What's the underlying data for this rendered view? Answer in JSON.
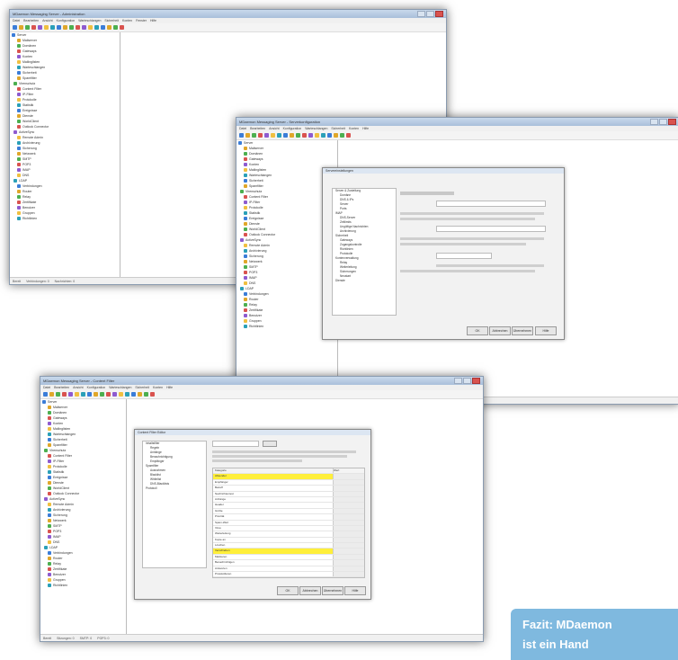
{
  "windows": [
    {
      "id": "main",
      "title": "MDaemon Messaging Server - Administration",
      "menus": [
        "Datei",
        "Bearbeiten",
        "Ansicht",
        "Konfiguration",
        "Warteschlangen",
        "Sicherheit",
        "Konten",
        "Fenster",
        "Hilfe"
      ],
      "tree": [
        "Server",
        "Mailserver",
        "Domänen",
        "Gateways",
        "Konten",
        "Mailinglisten",
        "Warteschlangen",
        "Sicherheit",
        "Spamfilter",
        "Virenschutz",
        "Content Filter",
        "IP-Filter",
        "Protokolle",
        "Statistik",
        "Ereignisse",
        "Dienste",
        "WorldClient",
        "Outlook Connector",
        "ActiveSync",
        "Remote Admin",
        "Archivierung",
        "Sicherung",
        "Netzwerk",
        "SMTP",
        "POP3",
        "IMAP",
        "DNS",
        "LDAP",
        "Verbindungen",
        "Router",
        "Relay",
        "Zertifikate",
        "Benutzer",
        "Gruppen",
        "Richtlinien"
      ],
      "status": [
        "Bereit",
        "Verbindungen: 0",
        "Nachrichten: 0"
      ]
    },
    {
      "id": "settings",
      "title": "MDaemon Messaging Server - Serverkonfiguration",
      "menus": [
        "Datei",
        "Bearbeiten",
        "Ansicht",
        "Konfiguration",
        "Warteschlangen",
        "Sicherheit",
        "Konten",
        "Hilfe"
      ],
      "dialog_title": "Servereinstellungen",
      "nav": [
        "Server & Zustellung",
        "Domäne",
        "DNS & IPs",
        "Server",
        "Ports",
        "IMAP",
        "DNS-Server",
        "Zeitlimits",
        "Ungültige Nachrichten",
        "Archivierung",
        "Sicherheit",
        "Gateways",
        "Zugangskontrolle",
        "Richtlinien",
        "Protokolle",
        "Kontenverwaltung",
        "Relay",
        "Weiterleitung",
        "Sicherungen",
        "Neustart",
        "Dienste"
      ],
      "buttons": [
        "OK",
        "Abbrechen",
        "Übernehmen",
        "Hilfe"
      ],
      "status": [
        "Bereit",
        "Sitzungen: 0",
        "SMTP: 0",
        "POP3: 0",
        "IMAP: 0"
      ]
    },
    {
      "id": "filter",
      "title": "MDaemon Messaging Server - Content Filter",
      "menus": [
        "Datei",
        "Bearbeiten",
        "Ansicht",
        "Konfiguration",
        "Warteschlangen",
        "Sicherheit",
        "Konten",
        "Hilfe"
      ],
      "dialog_title": "Content Filter Editor",
      "nav": [
        "Inhaltsfilter",
        "Regeln",
        "Anhänge",
        "Benachrichtigung",
        "Empfänger",
        "Spamfilter",
        "Ausnahmen",
        "Blacklist",
        "Whitelist",
        "DNS-Blacklists",
        "Protokoll"
      ],
      "grid_header": [
        "Kategorie",
        "Wert"
      ],
      "grid_rows": [
        {
          "label": "Absender",
          "hl": true
        },
        {
          "label": "Empfänger",
          "hl": false
        },
        {
          "label": "Betreff",
          "hl": false
        },
        {
          "label": "Nachrichtentext",
          "hl": false
        },
        {
          "label": "Anhänge",
          "hl": false
        },
        {
          "label": "Header",
          "hl": false
        },
        {
          "label": "Größe",
          "hl": false
        },
        {
          "label": "Priorität",
          "hl": false
        },
        {
          "label": "Spam-Wert",
          "hl": false
        },
        {
          "label": "Virus",
          "hl": false
        },
        {
          "label": "Weiterleitung",
          "hl": false
        },
        {
          "label": "Kopie an",
          "hl": false
        },
        {
          "label": "Löschen",
          "hl": false
        },
        {
          "label": "Verschieben",
          "hl": true
        },
        {
          "label": "Markieren",
          "hl": false
        },
        {
          "label": "Benachrichtigen",
          "hl": false
        },
        {
          "label": "Antworten",
          "hl": false
        },
        {
          "label": "Protokollieren",
          "hl": false
        }
      ],
      "buttons": [
        "OK",
        "Abbrechen",
        "Übernehmen",
        "Hilfe"
      ],
      "status": [
        "Bereit",
        "Sitzungen: 0",
        "SMTP: 0",
        "POP3: 0"
      ]
    }
  ],
  "fazit": {
    "line1": "Fazit: MDaemon",
    "line2": "ist ein Hand"
  },
  "colors": {
    "fazit_bg": "#7fb9df",
    "highlight": "#ffef3a",
    "titlebar": "#b9cce3"
  }
}
